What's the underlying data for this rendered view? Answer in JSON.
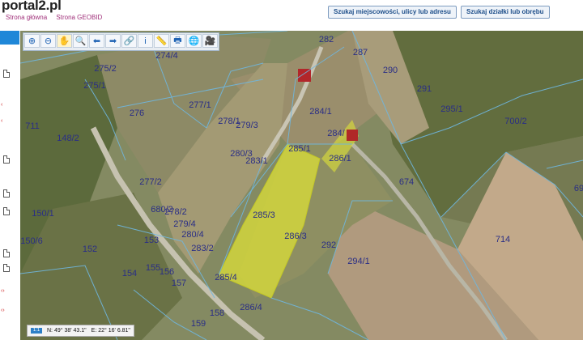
{
  "header": {
    "logo": "portal2.pl",
    "links": [
      "Strona główna",
      "Strona GEOBID"
    ],
    "search_address_label": "Szukaj miejscowości, ulicy lub adresu",
    "search_parcel_label": "Szukaj działki lub obrębu"
  },
  "toolbar": {
    "tools": [
      {
        "name": "zoom-in-icon",
        "glyph": "⊕"
      },
      {
        "name": "zoom-out-icon",
        "glyph": "⊖"
      },
      {
        "name": "pan-hand-icon",
        "glyph": "✋"
      },
      {
        "name": "zoom-box-icon",
        "glyph": "🔍"
      },
      {
        "name": "back-arrow-icon",
        "glyph": "⬅"
      },
      {
        "name": "forward-arrow-icon",
        "glyph": "➡"
      },
      {
        "name": "link-icon",
        "glyph": "🔗"
      },
      {
        "name": "info-icon",
        "glyph": "i"
      },
      {
        "name": "measure-icon",
        "glyph": "📏"
      },
      {
        "name": "print-icon",
        "glyph": "🖶"
      },
      {
        "name": "globe-icon",
        "glyph": "🌐"
      },
      {
        "name": "video-icon",
        "glyph": "🎥"
      }
    ]
  },
  "map": {
    "parcels": [
      "282",
      "287",
      "290",
      "291",
      "275/2",
      "274/4",
      "275/1",
      "277/1",
      "276",
      "278/1",
      "279/3",
      "711",
      "148/2",
      "295/1",
      "700/2",
      "284/1",
      "284/",
      "285/1",
      "286/1",
      "280/3",
      "283/1",
      "277/2",
      "674",
      "680/2",
      "278/2",
      "285/3",
      "279/4",
      "150/1",
      "280/4",
      "153",
      "286/3",
      "292",
      "714",
      "150/6",
      "152",
      "283/2",
      "294/1",
      "155",
      "156",
      "154",
      "157",
      "285/4",
      "286/4",
      "158",
      "159",
      "69"
    ],
    "highlight_color": "#d8dc3a",
    "boundary_color": "#6fb7e0"
  },
  "coords": {
    "scale_label": "1:1",
    "lat_label": "N: 49° 38' 43.1\"",
    "lon_label": "E: 22° 16' 6.81\""
  }
}
